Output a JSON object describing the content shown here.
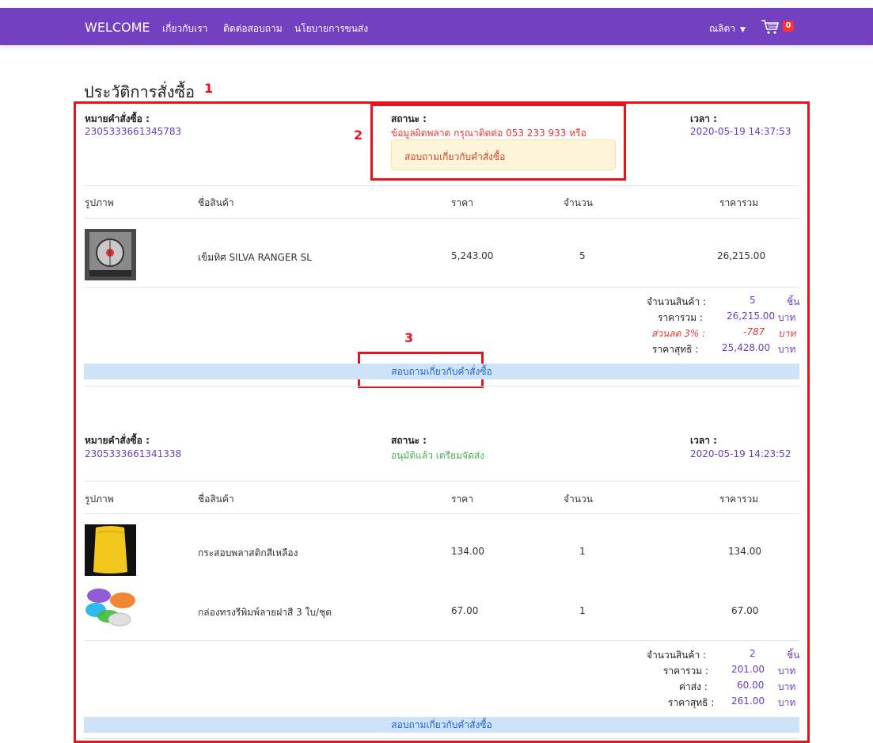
{
  "nav": {
    "brand": "WELCOME",
    "links": [
      "เกี่ยวกับเรา",
      "ติดต่อสอบถาม",
      "นโยบายการขนส่ง"
    ],
    "user": "ณลิตา",
    "cart_count": "0"
  },
  "page_title": "ประวัติการสั่งซื้อ",
  "annotations": [
    "1",
    "2",
    "3"
  ],
  "labels": {
    "order_no": "หมายคำสั่งซื้อ :",
    "status": "สถานะ :",
    "time": "เวลา :",
    "col_image": "รูปภาพ",
    "col_name": "ชื่อสินค้า",
    "col_price": "ราคา",
    "col_qty": "จำนวน",
    "col_total": "ราคารวม",
    "sum_qty": "จำนวนสินค้า :",
    "sum_total": "ราคารวม :",
    "sum_net": "ราคาสุทธิ :",
    "sum_shipping": "ค่าส่ง :",
    "unit_piece": "ชิ้น",
    "unit_baht": "บาท",
    "inquiry": "สอบถามเกี่ยวกับคำสั่งซื้อ"
  },
  "orders": [
    {
      "order_no": "2305333661345783",
      "status": "ข้อมูลผิดพลาด กรุณาติดต่อ 053 233 933 หรือ",
      "status_button": "สอบถามเกี่ยวกับคำสั่งซื้อ",
      "time": "2020-05-19 14:37:53",
      "items": [
        {
          "name": "เข็มทิศ SILVA RANGER SL",
          "price": "5,243.00",
          "qty": "5",
          "total": "26,215.00",
          "image_icon": "compass-product-image"
        }
      ],
      "summary": {
        "qty": "5",
        "total": "26,215.00",
        "discount_label": "ส่วนลด 3% :",
        "discount": "-787",
        "net": "25,428.00"
      },
      "inquiry": "สอบถามเกี่ยวกับคำสั่งซื้อ"
    },
    {
      "order_no": "2305333661341338",
      "status": "อนุมัติแล้ว เตรียมจัดส่ง",
      "time": "2020-05-19 14:23:52",
      "items": [
        {
          "name": "กระสอบพลาสติกสีเหลือง",
          "price": "134.00",
          "qty": "1",
          "total": "134.00",
          "image_icon": "yellow-sack-product-image"
        },
        {
          "name": "กล่องทรงรีพิมพ์ลายฝาสี 3 ใบ/ชุด",
          "price": "67.00",
          "qty": "1",
          "total": "67.00",
          "image_icon": "oval-containers-product-image"
        }
      ],
      "summary": {
        "qty": "2",
        "total": "201.00",
        "shipping": "60.00",
        "net": "261.00"
      },
      "inquiry": "สอบถามเกี่ยวกับคำสั่งซื้อ"
    }
  ],
  "colors": {
    "nav_bg": "#7340c2",
    "annotation_red": "#e8141b",
    "value_purple": "#6a3cbf",
    "status_error": "#e53935",
    "status_ok": "#4caf50",
    "inquiry_bar": "#cfe3f8"
  }
}
